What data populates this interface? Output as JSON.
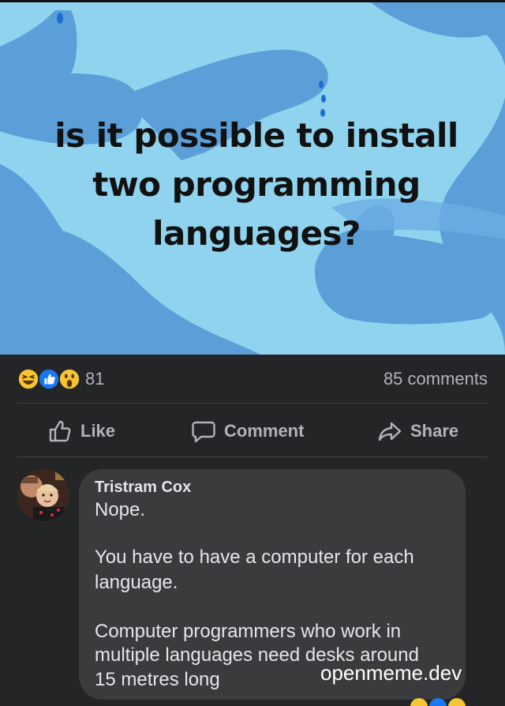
{
  "post": {
    "question_lines": [
      "is it possible to install",
      "two programming",
      "languages?"
    ]
  },
  "reactions": {
    "count": "81",
    "comments": "85 comments",
    "icons": [
      "haha-emoji-icon",
      "like-thumb-icon",
      "wow-emoji-icon"
    ]
  },
  "actions": {
    "like": "Like",
    "comment": "Comment",
    "share": "Share"
  },
  "comment": {
    "author": "Tristram Cox",
    "paragraphs": [
      "Nope.",
      "You have to have a computer for each language.",
      "Computer programmers who work in multiple languages need desks around 15 metres long"
    ],
    "lines": {
      "p1": [
        "Nope."
      ],
      "p2": [
        "You have to have a computer for each",
        "language."
      ],
      "p3": [
        "Computer programmers who work in",
        "multiple languages need desks around",
        "15 metres long"
      ]
    }
  },
  "watermark": "openmeme.dev",
  "colors": {
    "image_bg": "#8fd3ee",
    "hand_blue": "#5b9fd9",
    "dark_bg": "#242526",
    "bubble": "#3a3b3c",
    "muted_text": "#b0b3b8",
    "text": "#e4e6eb",
    "like_blue": "#1877f2"
  }
}
